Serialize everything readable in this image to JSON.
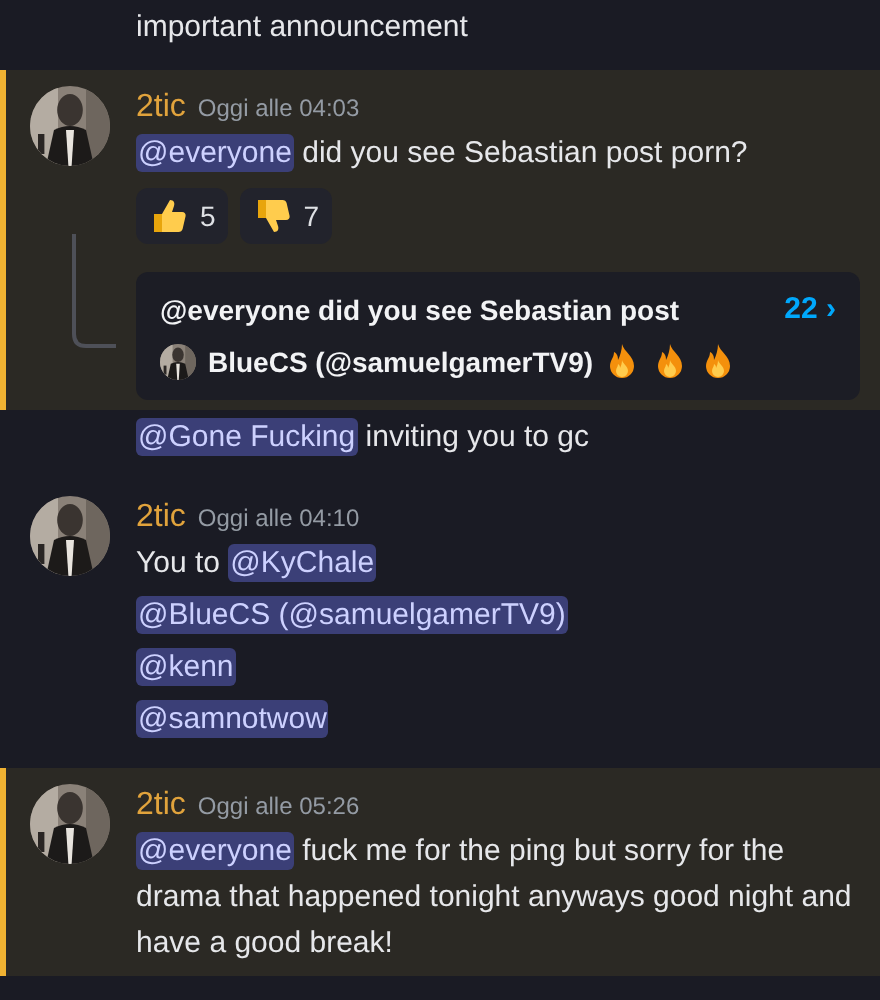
{
  "messages": [
    {
      "kind": "continuation",
      "highlighted": false,
      "lines": [
        [
          {
            "kind": "text",
            "text": "important announcement"
          }
        ]
      ]
    },
    {
      "kind": "header",
      "highlighted": true,
      "author": "2tic",
      "time": "Oggi alle 04:03",
      "lines": [
        [
          {
            "kind": "mention",
            "text": "@everyone"
          },
          {
            "kind": "text",
            "text": " did you see Sebastian post porn?"
          }
        ]
      ],
      "reactions": [
        {
          "kind": "thumbs_up",
          "count": "5"
        },
        {
          "kind": "thumbs_down",
          "count": "7"
        }
      ],
      "thread": {
        "title": "@everyone did you see Sebastian post",
        "count": "22",
        "chevron": "›",
        "last_author": "BlueCS (@samuelgamerTV9)",
        "emojis": [
          {
            "kind": "fire"
          },
          {
            "kind": "fire"
          },
          {
            "kind": "fire"
          }
        ]
      }
    },
    {
      "kind": "continuation",
      "highlighted": false,
      "lines": [
        [
          {
            "kind": "mention",
            "text": "@Gone Fucking"
          },
          {
            "kind": "text",
            "text": " inviting you to gc"
          }
        ]
      ]
    },
    {
      "kind": "header",
      "highlighted": false,
      "author": "2tic",
      "time": "Oggi alle 04:10",
      "lines": [
        [
          {
            "kind": "text",
            "text": "You to "
          },
          {
            "kind": "mention",
            "text": "@KyChale"
          }
        ],
        [
          {
            "kind": "mention",
            "text": "@BlueCS (@samuelgamerTV9)"
          }
        ],
        [
          {
            "kind": "mention",
            "text": "@kenn"
          }
        ],
        [
          {
            "kind": "mention",
            "text": "@samnotwow"
          }
        ]
      ]
    },
    {
      "kind": "header",
      "highlighted": true,
      "author": "2tic",
      "time": "Oggi alle 05:26",
      "lines": [
        [
          {
            "kind": "mention",
            "text": "@everyone"
          },
          {
            "kind": "text",
            "text": " fuck me for the ping but sorry for the drama that happened tonight anyways good night and have a good break!"
          }
        ]
      ]
    }
  ]
}
